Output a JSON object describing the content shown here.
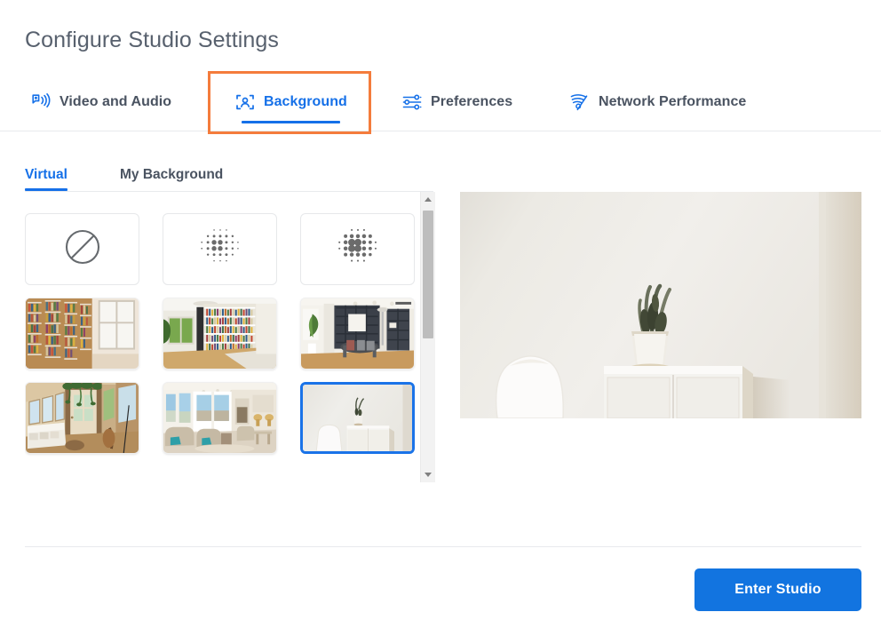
{
  "header": {
    "title": "Configure Studio Settings"
  },
  "tabs": [
    {
      "id": "video",
      "label": "Video and Audio",
      "icon": "camera-audio-icon",
      "active": false
    },
    {
      "id": "background",
      "label": "Background",
      "icon": "person-frame-icon",
      "active": true
    },
    {
      "id": "preferences",
      "label": "Preferences",
      "icon": "sliders-icon",
      "active": false
    },
    {
      "id": "network",
      "label": "Network Performance",
      "icon": "wifi-icon",
      "active": false
    }
  ],
  "subtabs": [
    {
      "id": "virtual",
      "label": "Virtual",
      "active": true
    },
    {
      "id": "my-background",
      "label": "My Background",
      "active": false
    }
  ],
  "backgrounds": [
    {
      "id": "none",
      "type": "icon",
      "icon": "no-background-icon",
      "label": "None",
      "selected": false
    },
    {
      "id": "blur-light",
      "type": "icon",
      "icon": "blur-light-icon",
      "label": "Slight Blur",
      "selected": false
    },
    {
      "id": "blur-strong",
      "type": "icon",
      "icon": "blur-strong-icon",
      "label": "Blur",
      "selected": false
    },
    {
      "id": "library-1",
      "type": "photo",
      "scene": "library-window",
      "label": "Library with Window",
      "selected": false
    },
    {
      "id": "library-2",
      "type": "photo",
      "scene": "library-green",
      "label": "Bookshelf Room",
      "selected": false
    },
    {
      "id": "office-1",
      "type": "photo",
      "scene": "office-dark-shelf",
      "label": "Modern Office",
      "selected": false
    },
    {
      "id": "attic-1",
      "type": "photo",
      "scene": "attic-plants",
      "label": "Attic Lounge",
      "selected": false
    },
    {
      "id": "livingroom-1",
      "type": "photo",
      "scene": "living-room",
      "label": "Bright Living Room",
      "selected": false
    },
    {
      "id": "minimal-1",
      "type": "photo",
      "scene": "minimal-cabinet",
      "label": "Minimal White Room",
      "selected": true
    }
  ],
  "preview": {
    "scene": "minimal-cabinet",
    "alt": "Minimal white room with plant on cabinet"
  },
  "scrollbar": {
    "up_icon": "chevron-up-icon",
    "down_icon": "chevron-down-icon"
  },
  "footer": {
    "enter_studio_label": "Enter Studio"
  },
  "colors": {
    "accent": "#1570e8",
    "primary_button": "#1274e0",
    "focus_ring": "#f47c3c",
    "selected_border": "#1a73e8",
    "text": "#4a5361",
    "title": "#58616e",
    "divider": "#e8eaed"
  }
}
